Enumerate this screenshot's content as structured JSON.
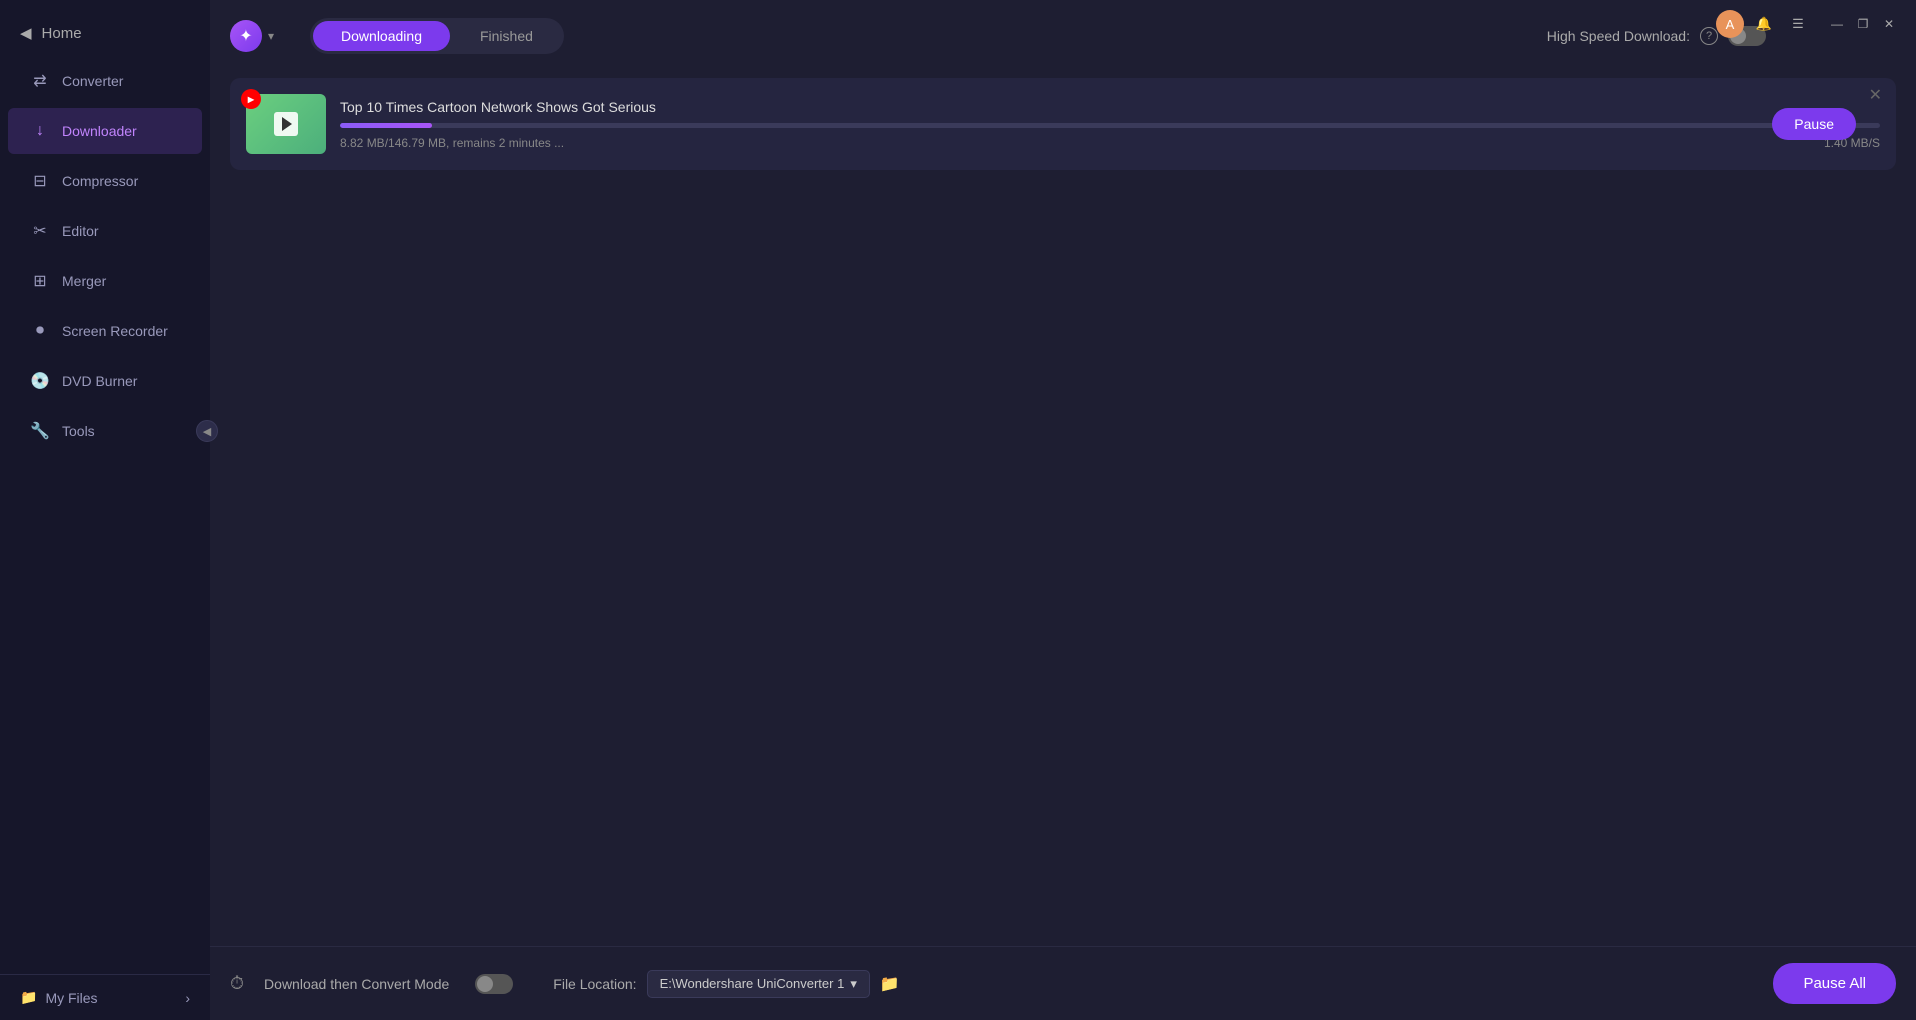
{
  "sidebar": {
    "home_label": "Home",
    "collapse_icon": "◀",
    "items": [
      {
        "id": "converter",
        "label": "Converter",
        "icon": "⇄"
      },
      {
        "id": "downloader",
        "label": "Downloader",
        "icon": "↓",
        "active": true
      },
      {
        "id": "compressor",
        "label": "Compressor",
        "icon": "⊟"
      },
      {
        "id": "editor",
        "label": "Editor",
        "icon": "✂"
      },
      {
        "id": "merger",
        "label": "Merger",
        "icon": "⊞"
      },
      {
        "id": "screen-recorder",
        "label": "Screen Recorder",
        "icon": "⏺"
      },
      {
        "id": "dvd-burner",
        "label": "DVD Burner",
        "icon": "💿"
      },
      {
        "id": "tools",
        "label": "Tools",
        "icon": "🔧"
      }
    ],
    "my_files_label": "My Files",
    "my_files_arrow": "›"
  },
  "titlebar": {
    "user_initial": "A",
    "notification_icon": "🔔",
    "menu_icon": "☰",
    "minimize_icon": "—",
    "restore_icon": "❐",
    "close_icon": "✕"
  },
  "header": {
    "logo_icon": "✦",
    "logo_dropdown": "▾",
    "tabs": [
      {
        "id": "downloading",
        "label": "Downloading",
        "active": true
      },
      {
        "id": "finished",
        "label": "Finished",
        "active": false
      }
    ],
    "high_speed_label": "High Speed Download:",
    "high_speed_toggle": false,
    "help_icon": "?"
  },
  "download_card": {
    "title": "Top 10 Times Cartoon Network Shows Got Serious",
    "source_badge": "▶",
    "progress_percent": 6,
    "progress_text": "8.82 MB/146.79 MB, remains 2 minutes ...",
    "speed_text": "1.40 MB/S",
    "pause_button_label": "Pause",
    "close_icon": "✕"
  },
  "footer": {
    "download_convert_label": "Download then Convert Mode",
    "toggle_on": false,
    "file_location_label": "File Location:",
    "file_path": "E:\\Wondershare UniConverter 1",
    "dropdown_arrow": "▾",
    "folder_icon": "📁",
    "pause_all_label": "Pause All"
  }
}
